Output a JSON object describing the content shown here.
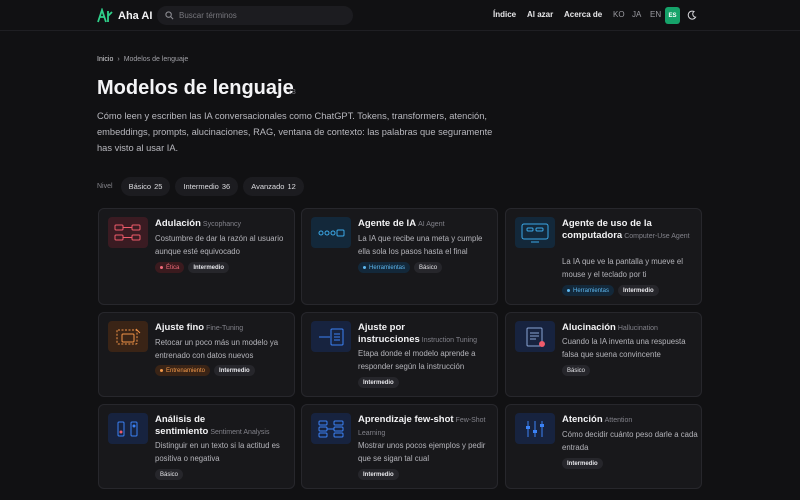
{
  "header": {
    "logo_text": "Aha AI",
    "search_placeholder": "Buscar términos",
    "nav": [
      "Índice",
      "Al azar",
      "Acerca de"
    ],
    "langs": [
      "KO",
      "JA",
      "EN",
      "ES"
    ]
  },
  "breadcrumb": {
    "home": "Inicio",
    "sep": "›",
    "current": "Modelos de lenguaje"
  },
  "page": {
    "title": "Modelos de lenguaje",
    "count": "73",
    "description": "Cómo leen y escriben las IA conversacionales como ChatGPT. Tokens, transformers, atención, embeddings, prompts, alucinaciones, RAG, ventana de contexto: las palabras que seguramente has visto al usar IA."
  },
  "levels": {
    "label": "Nivel",
    "items": [
      {
        "name": "Básico",
        "count": "25"
      },
      {
        "name": "Intermedio",
        "count": "36"
      },
      {
        "name": "Avanzado",
        "count": "12"
      }
    ]
  },
  "cards": [
    {
      "title": "Adulación",
      "en": "Sycophancy",
      "desc": "Costumbre de dar la razón al usuario aunque esté equivocado",
      "tags": [
        {
          "label": "Ética",
          "style": "red"
        },
        {
          "label": "Intermedio",
          "style": "plain"
        }
      ],
      "icon": "flow-diagram-icon",
      "color": "#ef5b6b"
    },
    {
      "title": "Agente de IA",
      "en": "AI Agent",
      "desc": "La IA que recibe una meta y cumple ella sola los pasos hasta el final",
      "tags": [
        {
          "label": "Herramientas",
          "style": "blue"
        },
        {
          "label": "Básico",
          "style": "plain"
        }
      ],
      "icon": "agent-loop-icon",
      "color": "#3ba9e8"
    },
    {
      "title": "Agente de uso de la computadora",
      "en": "Computer-Use Agent",
      "desc": "La IA que ve la pantalla y mueve el mouse y el teclado por ti",
      "tags": [
        {
          "label": "Herramientas",
          "style": "blue"
        },
        {
          "label": "Intermedio",
          "style": "plain"
        }
      ],
      "icon": "screen-icon",
      "color": "#3ba9e8"
    },
    {
      "title": "Ajuste fino",
      "en": "Fine-Tuning",
      "desc": "Retocar un poco más un modelo ya entrenado con datos nuevos",
      "tags": [
        {
          "label": "Entrenamiento",
          "style": "orange"
        },
        {
          "label": "Intermedio",
          "style": "plain"
        }
      ],
      "icon": "tuning-icon",
      "color": "#f29448"
    },
    {
      "title": "Ajuste por instrucciones",
      "en": "Instruction Tuning",
      "desc": "Etapa donde el modelo aprende a responder según la instrucción",
      "tags": [
        {
          "label": "Intermedio",
          "style": "plain"
        }
      ],
      "icon": "instruction-icon",
      "color": "#3b82f6"
    },
    {
      "title": "Alucinación",
      "en": "Hallucination",
      "desc": "Cuando la IA inventa una respuesta falsa que suena convincente",
      "tags": [
        {
          "label": "Básico",
          "style": "plain"
        }
      ],
      "icon": "document-warning-icon",
      "color": "#3b82f6"
    },
    {
      "title": "Análisis de sentimiento",
      "en": "Sentiment Analysis",
      "desc": "Distinguir en un texto si la actitud es positiva o negativa",
      "tags": [
        {
          "label": "Básico",
          "style": "plain"
        }
      ],
      "icon": "sentiment-icon",
      "color": "#3b82f6"
    },
    {
      "title": "Aprendizaje few-shot",
      "en": "Few-Shot Learning",
      "desc": "Mostrar unos pocos ejemplos y pedir que se sigan tal cual",
      "tags": [
        {
          "label": "Intermedio",
          "style": "plain"
        }
      ],
      "icon": "examples-icon",
      "color": "#3b82f6"
    },
    {
      "title": "Atención",
      "en": "Attention",
      "desc": "Cómo decidir cuánto peso darle a cada entrada",
      "tags": [
        {
          "label": "Intermedio",
          "style": "plain"
        }
      ],
      "icon": "attention-icon",
      "color": "#3b82f6"
    }
  ]
}
